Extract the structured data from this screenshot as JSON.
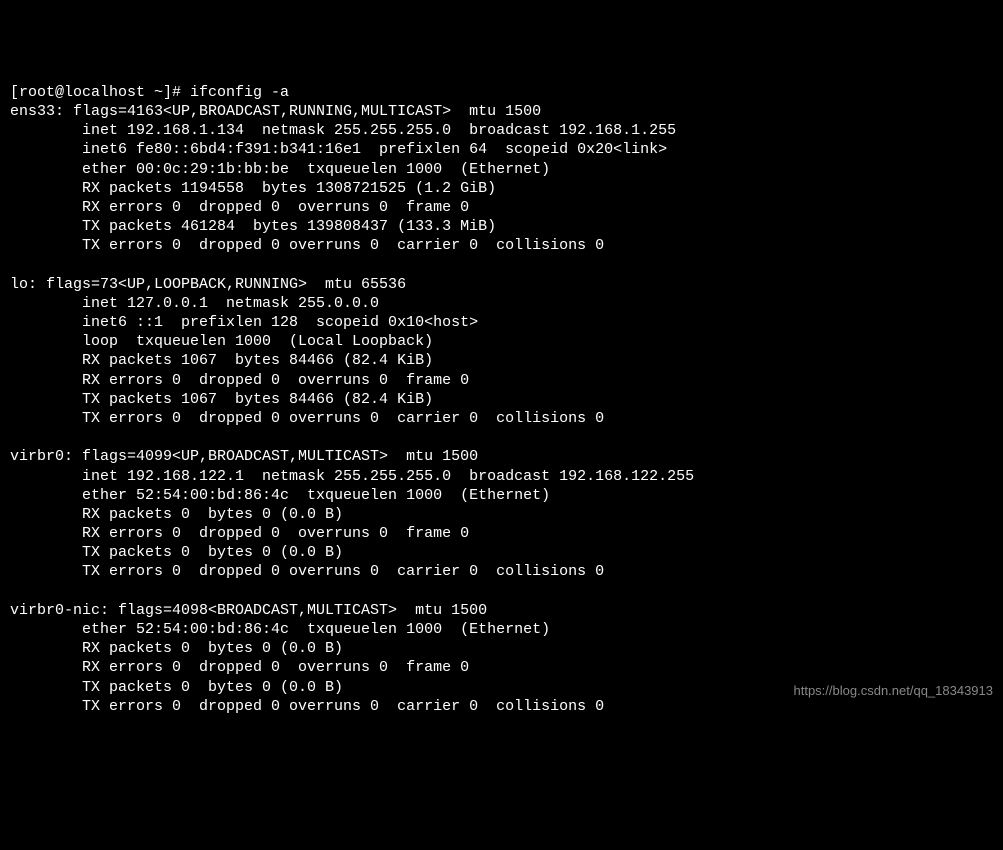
{
  "prompt": "[root@localhost ~]# ",
  "command": "ifconfig -a",
  "interfaces": {
    "ens33": {
      "header": "ens33: flags=4163<UP,BROADCAST,RUNNING,MULTICAST>  mtu 1500",
      "inet": "        inet 192.168.1.134  netmask 255.255.255.0  broadcast 192.168.1.255",
      "inet6": "        inet6 fe80::6bd4:f391:b341:16e1  prefixlen 64  scopeid 0x20<link>",
      "ether": "        ether 00:0c:29:1b:bb:be  txqueuelen 1000  (Ethernet)",
      "rxp": "        RX packets 1194558  bytes 1308721525 (1.2 GiB)",
      "rxe": "        RX errors 0  dropped 0  overruns 0  frame 0",
      "txp": "        TX packets 461284  bytes 139808437 (133.3 MiB)",
      "txe": "        TX errors 0  dropped 0 overruns 0  carrier 0  collisions 0"
    },
    "lo": {
      "header": "lo: flags=73<UP,LOOPBACK,RUNNING>  mtu 65536",
      "inet": "        inet 127.0.0.1  netmask 255.0.0.0",
      "inet6": "        inet6 ::1  prefixlen 128  scopeid 0x10<host>",
      "loop": "        loop  txqueuelen 1000  (Local Loopback)",
      "rxp": "        RX packets 1067  bytes 84466 (82.4 KiB)",
      "rxe": "        RX errors 0  dropped 0  overruns 0  frame 0",
      "txp": "        TX packets 1067  bytes 84466 (82.4 KiB)",
      "txe": "        TX errors 0  dropped 0 overruns 0  carrier 0  collisions 0"
    },
    "virbr0": {
      "header": "virbr0: flags=4099<UP,BROADCAST,MULTICAST>  mtu 1500",
      "inet": "        inet 192.168.122.1  netmask 255.255.255.0  broadcast 192.168.122.255",
      "ether": "        ether 52:54:00:bd:86:4c  txqueuelen 1000  (Ethernet)",
      "rxp": "        RX packets 0  bytes 0 (0.0 B)",
      "rxe": "        RX errors 0  dropped 0  overruns 0  frame 0",
      "txp": "        TX packets 0  bytes 0 (0.0 B)",
      "txe": "        TX errors 0  dropped 0 overruns 0  carrier 0  collisions 0"
    },
    "virbr0nic": {
      "header": "virbr0-nic: flags=4098<BROADCAST,MULTICAST>  mtu 1500",
      "ether": "        ether 52:54:00:bd:86:4c  txqueuelen 1000  (Ethernet)",
      "rxp": "        RX packets 0  bytes 0 (0.0 B)",
      "rxe": "        RX errors 0  dropped 0  overruns 0  frame 0",
      "txp": "        TX packets 0  bytes 0 (0.0 B)",
      "txe": "        TX errors 0  dropped 0 overruns 0  carrier 0  collisions 0"
    }
  },
  "watermark": "https://blog.csdn.net/qq_18343913"
}
